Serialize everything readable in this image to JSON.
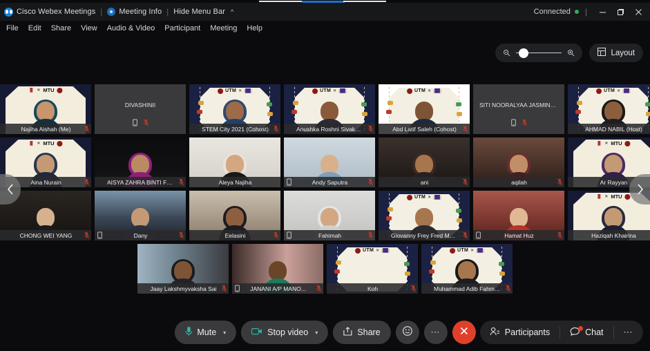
{
  "app": {
    "title": "Cisco Webex Meetings",
    "meeting_info": "Meeting Info",
    "hide_menu_bar": "Hide Menu Bar",
    "connection_status": "Connected",
    "accent_color": "#1683d8",
    "status_color": "#36a85e"
  },
  "window_controls": {
    "minimize": "minimize-button",
    "maximize": "maximize-button",
    "close": "close-button"
  },
  "menubar": {
    "items": [
      {
        "label": "File"
      },
      {
        "label": "Edit"
      },
      {
        "label": "Share"
      },
      {
        "label": "View"
      },
      {
        "label": "Audio & Video"
      },
      {
        "label": "Participant"
      },
      {
        "label": "Meeting"
      },
      {
        "label": "Help"
      }
    ]
  },
  "view_controls": {
    "zoom_out_icon": "zoom-out-icon",
    "zoom_in_icon": "zoom-in-icon",
    "zoom_value": 8,
    "layout_label": "Layout",
    "layout_icon": "grid-layout-icon"
  },
  "navigation": {
    "prev_label": "‹",
    "next_label": "›"
  },
  "grid": {
    "rows": [
      {
        "tiles": [
          {
            "name": "Najiha Aishah  (Me)",
            "video": true,
            "bg": "mtu",
            "muted": true,
            "phone": false,
            "skin": "#c8956d",
            "hijab": "#18495a",
            "cloth": "#123040"
          },
          {
            "name": "DIVASHINII",
            "video": false,
            "muted": true,
            "phone": true
          },
          {
            "name": "STEM City 2021 (Cohost)",
            "video": true,
            "bg": "utm",
            "muted": true,
            "phone": false,
            "skin": "#9d6b48",
            "hijab": "#2e4a72",
            "cloth": "#24406a"
          },
          {
            "name": "Anushka Roshni Sivakum...",
            "video": true,
            "bg": "utm",
            "muted": true,
            "phone": false,
            "skin": "#8a5a3a",
            "hijab": "",
            "cloth": "#2a2a38"
          },
          {
            "name": "Abd Latif Saleh  (Cohost)",
            "video": true,
            "bg": "utm-light",
            "muted": true,
            "phone": false,
            "skin": "#7e5436",
            "hijab": "",
            "cloth": "#1c2a3c"
          },
          {
            "name": "SITI NOORALYAA JASMINE BIN...",
            "video": false,
            "muted": true,
            "phone": true
          },
          {
            "name": "AHMAD NABIL  (Host)",
            "video": true,
            "bg": "utm",
            "muted": true,
            "phone": false,
            "skin": "#8c5e3c",
            "hijab": "#1a1a1a",
            "cloth": "#1e1e22"
          }
        ]
      },
      {
        "tiles": [
          {
            "name": "Aina Nurain",
            "video": true,
            "bg": "mtu",
            "muted": true,
            "phone": false,
            "skin": "#c49a74",
            "hijab": "#2a3550",
            "cloth": "#22283c"
          },
          {
            "name": "AISYA ZAHRA BINTI FIRD...",
            "video": true,
            "bg": "plain-dark",
            "muted": true,
            "phone": false,
            "skin": "#b98a63",
            "hijab": "#8e1f78",
            "cloth": "#8e1f78"
          },
          {
            "name": "Aleya Najiha",
            "video": true,
            "bg": "plain-light",
            "muted": false,
            "phone": false,
            "skin": "#d2a782",
            "hijab": "#e8e2da",
            "cloth": "#181818"
          },
          {
            "name": "Andy Saputra",
            "video": true,
            "bg": "plain-light2",
            "muted": true,
            "phone": true,
            "skin": "#d8b08c",
            "hijab": "",
            "cloth": "#7fa0b8"
          },
          {
            "name": "ani",
            "video": true,
            "bg": "room-dark",
            "muted": true,
            "phone": false,
            "skin": "#a8764e",
            "hijab": "#3a2a22",
            "cloth": "#262022"
          },
          {
            "name": "aqilah",
            "video": true,
            "bg": "room-warm",
            "muted": true,
            "phone": false,
            "skin": "#c08f68",
            "hijab": "#6a2e2e",
            "cloth": "#402024"
          },
          {
            "name": "Ar Rayyan",
            "video": true,
            "bg": "mtu",
            "muted": false,
            "phone": false,
            "skin": "#c49a74",
            "hijab": "#4a2c60",
            "cloth": "#30204a"
          }
        ]
      },
      {
        "tiles": [
          {
            "name": "CHONG WEI YANG",
            "video": true,
            "bg": "plain-dark2",
            "muted": true,
            "phone": false,
            "skin": "#d6b18e",
            "hijab": "",
            "cloth": "#1a1a1e"
          },
          {
            "name": "Dany",
            "video": true,
            "bg": "outdoor",
            "muted": true,
            "phone": true,
            "skin": "#c49a74",
            "hijab": "",
            "cloth": "#2a3040"
          },
          {
            "name": "Eelasini",
            "video": true,
            "bg": "room-light",
            "muted": true,
            "phone": false,
            "skin": "#8e5f3e",
            "hijab": "#1c1c20",
            "cloth": "#1c1c20"
          },
          {
            "name": "Fahimah",
            "video": true,
            "bg": "plain-grey",
            "muted": true,
            "phone": true,
            "skin": "#d2a782",
            "hijab": "#e4e4e4",
            "cloth": "#cfcfcf"
          },
          {
            "name": "Giovanny Frey Fred Mali...",
            "video": true,
            "bg": "utm",
            "muted": true,
            "phone": false,
            "skin": "#a8764e",
            "hijab": "",
            "cloth": "#2a2a30"
          },
          {
            "name": "Hamat Huz",
            "video": true,
            "bg": "room-red",
            "muted": true,
            "phone": true,
            "skin": "#e0b894",
            "hijab": "",
            "cloth": "#b8332a"
          },
          {
            "name": "Haziqah Khairina",
            "video": true,
            "bg": "mtu",
            "muted": true,
            "phone": false,
            "skin": "#c49a74",
            "hijab": "#2a2a3e",
            "cloth": "#1e2030"
          }
        ]
      },
      {
        "tiles": [
          {
            "name": "Jaay Lakshmyvaksha Sai",
            "video": true,
            "bg": "room-window",
            "muted": true,
            "phone": false,
            "skin": "#7e5436",
            "hijab": "#1c1c1e",
            "cloth": "#23232a"
          },
          {
            "name": "JANANI A/P MANO...",
            "video": true,
            "bg": "room-pink",
            "muted": true,
            "phone": true,
            "skin": "#6a4528",
            "hijab": "",
            "cloth": "#1e7a5e"
          },
          {
            "name": "Koh",
            "video": true,
            "bg": "utm",
            "muted": true,
            "phone": false,
            "skin": "",
            "hijab": "",
            "cloth": ""
          },
          {
            "name": "Muhammad Adib Fahmy...",
            "video": true,
            "bg": "utm",
            "muted": true,
            "phone": false,
            "skin": "#a8764e",
            "hijab": "#1a1a1a",
            "cloth": "#1c1c22"
          }
        ]
      }
    ]
  },
  "toolbar": {
    "mute_label": "Mute",
    "mute_icon": "microphone-icon",
    "stop_video_label": "Stop video",
    "stop_video_icon": "camera-icon",
    "share_label": "Share",
    "share_icon": "share-upload-icon",
    "reactions_icon": "smiley-reaction-icon",
    "more_icon": "more-options-icon",
    "leave_icon": "end-meeting-icon",
    "participants_label": "Participants",
    "participants_icon": "participants-icon",
    "chat_label": "Chat",
    "chat_icon": "chat-bubble-icon",
    "chat_has_notification": true,
    "right_more_icon": "more-options-icon",
    "leave_color": "#e0402a",
    "accent_teal": "#2fb4a8"
  }
}
